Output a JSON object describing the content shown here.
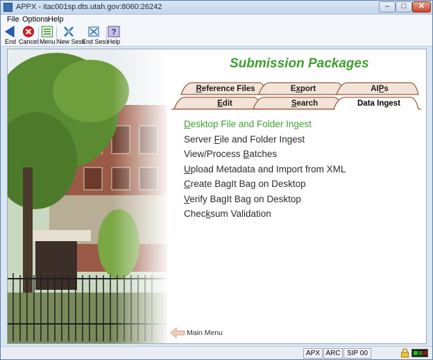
{
  "window": {
    "title": "APPX - itac001sp.dts.utah.gov:8060:26242",
    "minimize": "–",
    "maximize": "□",
    "close": "✕"
  },
  "menubar": {
    "items": [
      "File",
      "Options",
      "Help"
    ]
  },
  "toolbar": {
    "end": "End",
    "cancel": "Cancel",
    "menu": "Menu",
    "new_sess": "New Sess",
    "end_sess": "End Sess",
    "help": "Help"
  },
  "page": {
    "title": "Submission Packages"
  },
  "tabs": {
    "back_row": [
      {
        "pre": "",
        "key": "R",
        "post": "eference Files"
      },
      {
        "pre": "E",
        "key": "x",
        "post": "port"
      },
      {
        "pre": "AI",
        "key": "P",
        "post": "s"
      }
    ],
    "front_row": [
      {
        "pre": "",
        "key": "E",
        "post": "dit"
      },
      {
        "pre": "",
        "key": "S",
        "post": "earch"
      },
      {
        "pre": "Data Ingest",
        "key": "",
        "post": ""
      }
    ],
    "active": "Data Ingest"
  },
  "links": [
    {
      "pre": "",
      "key": "D",
      "post": "esktop File and Folder Ingest",
      "current": true
    },
    {
      "pre": "Server ",
      "key": "F",
      "post": "ile and Folder Ingest"
    },
    {
      "pre": "View/Process ",
      "key": "B",
      "post": "atches"
    },
    {
      "pre": "",
      "key": "U",
      "post": "pload Metadata and Import from XML"
    },
    {
      "pre": "",
      "key": "C",
      "post": "reate BagIt Bag on Desktop"
    },
    {
      "pre": "",
      "key": "V",
      "post": "erify BagIt Bag on Desktop"
    },
    {
      "pre": "Chec",
      "key": "k",
      "post": "sum Validation"
    }
  ],
  "main_menu": {
    "label": "Main Menu"
  },
  "statusbar": {
    "cells": [
      "APX",
      "ARC",
      "SIP 00"
    ]
  },
  "colors": {
    "accent_green": "#3ca02e",
    "tab_fill": "#f2e4d8",
    "tab_border": "#9c5a3c"
  }
}
